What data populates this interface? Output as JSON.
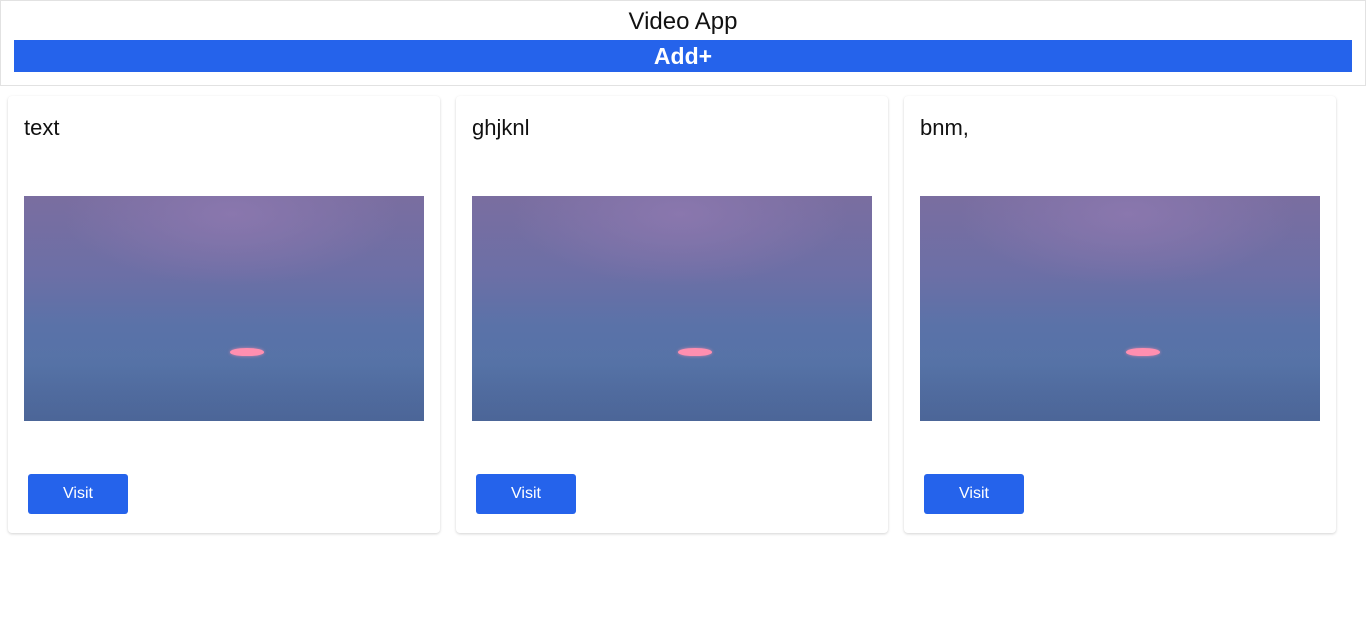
{
  "header": {
    "title": "Video App",
    "add_label": "Add+"
  },
  "cards": [
    {
      "title": "text",
      "button_label": "Visit"
    },
    {
      "title": "ghjknl",
      "button_label": "Visit"
    },
    {
      "title": "bnm,",
      "button_label": "Visit"
    }
  ],
  "colors": {
    "accent": "#2563eb",
    "thumbnail_sun": "#ff8fb0"
  }
}
